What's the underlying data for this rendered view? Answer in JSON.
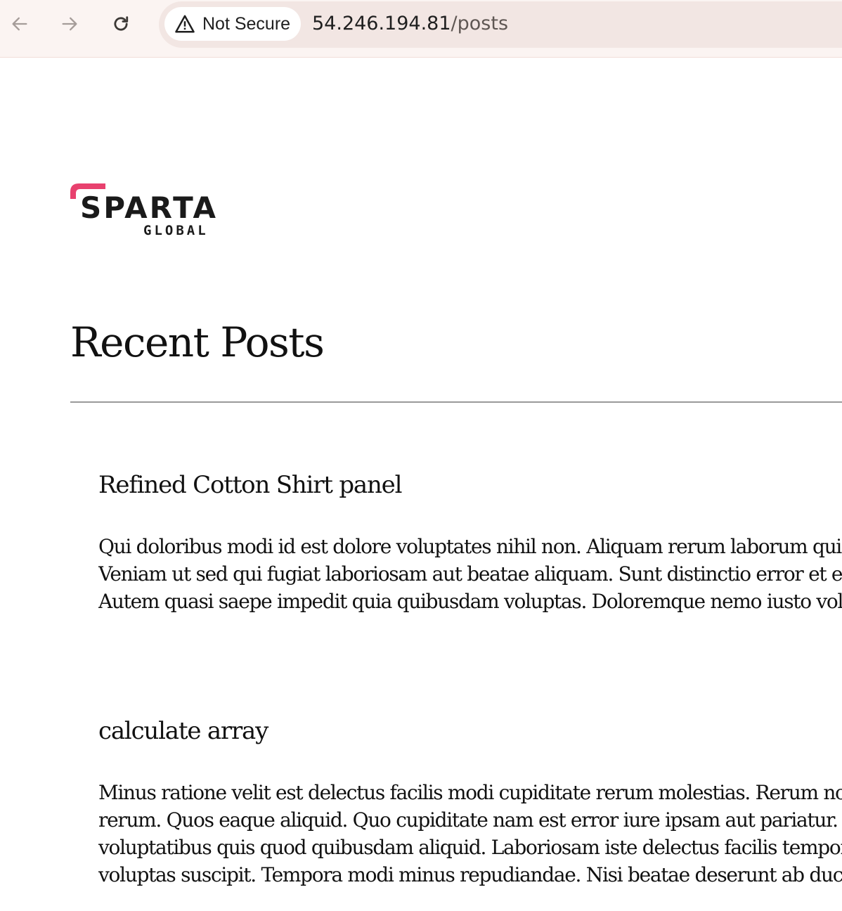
{
  "browser": {
    "back_icon": "arrow-left-icon",
    "forward_icon": "arrow-right-icon",
    "reload_icon": "reload-icon",
    "security_icon": "warning-triangle-icon",
    "security_label": "Not Secure",
    "url_host": "54.246.194.81",
    "url_path": "/posts"
  },
  "header": {
    "logo_text": "SPARTA",
    "logo_subtext": "GLOBAL",
    "logo_accent_color": "#e8416e"
  },
  "main": {
    "title": "Recent Posts",
    "posts": [
      {
        "title": "Refined Cotton Shirt panel",
        "lines": [
          "Qui doloribus modi id est dolore voluptates nihil non. Aliquam rerum laborum quider",
          "Veniam ut sed qui fugiat laboriosam aut beatae aliquam. Sunt distinctio error et et ad",
          "Autem quasi saepe impedit quia quibusdam voluptas. Doloremque nemo iusto volup"
        ]
      },
      {
        "title": "calculate array",
        "lines": [
          "Minus ratione velit est delectus facilis modi cupiditate rerum molestias. Rerum nostr",
          "rerum. Quos eaque aliquid. Quo cupiditate nam est error iure ipsam aut pariatur. Elig",
          "voluptatibus quis quod quibusdam aliquid. Laboriosam iste delectus facilis tempora",
          "voluptas suscipit. Tempora modi minus repudiandae. Nisi beatae deserunt ab ducim"
        ]
      }
    ]
  }
}
